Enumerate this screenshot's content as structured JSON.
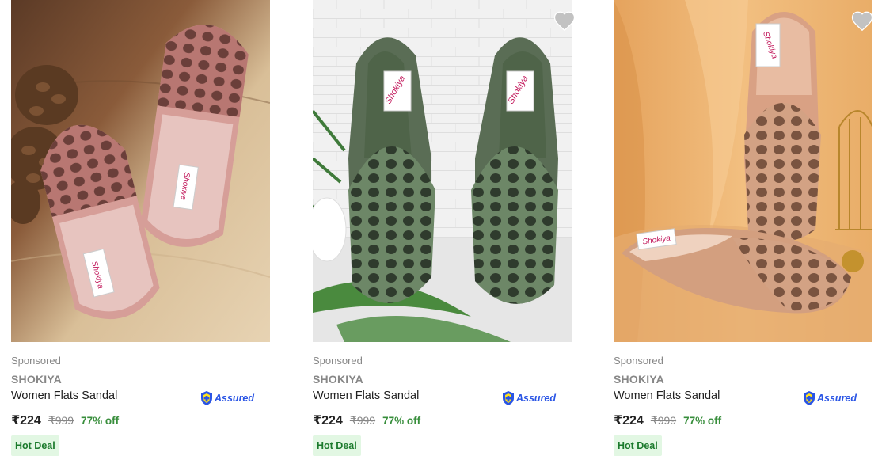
{
  "products": [
    {
      "sponsored": "Sponsored",
      "brand": "SHOKIYA",
      "title": "Women Flats Sandal",
      "assured": "Assured",
      "price": "₹224",
      "mrp": "₹999",
      "discount": "77% off",
      "badge": "Hot Deal",
      "color": "#c88a86",
      "logo": "Shokiya"
    },
    {
      "sponsored": "Sponsored",
      "brand": "SHOKIYA",
      "title": "Women Flats Sandal",
      "assured": "Assured",
      "price": "₹224",
      "mrp": "₹999",
      "discount": "77% off",
      "badge": "Hot Deal",
      "color": "#5c7458",
      "logo": "Shokiya"
    },
    {
      "sponsored": "Sponsored",
      "brand": "SHOKIYA",
      "title": "Women Flats Sandal",
      "assured": "Assured",
      "price": "₹224",
      "mrp": "₹999",
      "discount": "77% off",
      "badge": "Hot Deal",
      "color": "#c99a79",
      "logo": "Shokiya"
    }
  ],
  "icons": {
    "wishlist": "heart-icon",
    "assured": "assured-shield-icon"
  }
}
